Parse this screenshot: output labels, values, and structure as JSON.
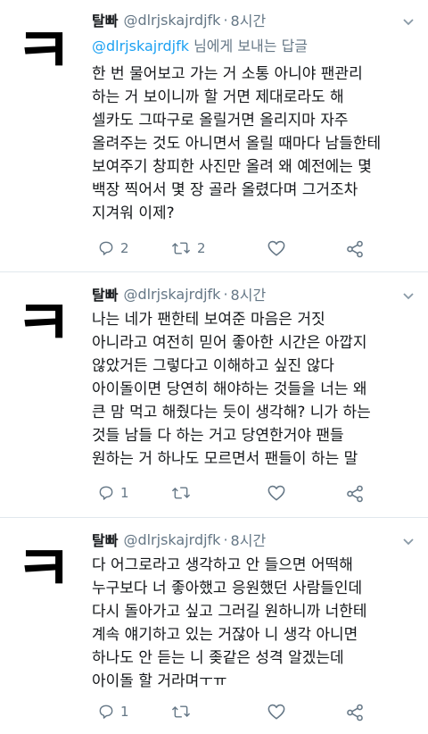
{
  "tweets": [
    {
      "avatar_char": "ㅋ",
      "name": "탈빠",
      "handle": "@dlrjskajrdjfk",
      "time": "8시간",
      "reply_to": {
        "mention": "@dlrjskajrdjfk",
        "suffix": " 님에게 보내는 답글"
      },
      "lines": [
        "한 번 물어보고 가는 거 소통 아니야 팬관리",
        "하는 거 보이니까 할 거면 제대로라도 해",
        "셀카도 그따구로 올릴거면 올리지마 자주",
        "올려주는 것도 아니면서 올릴 때마다 남들한테",
        "보여주기 창피한 사진만 올려 왜 예전에는 몇",
        "백장 찍어서 몇 장 골라 올렸다며 그거조차",
        "지겨워 이제?"
      ],
      "reply_count": "2",
      "retweet_count": "2"
    },
    {
      "avatar_char": "ㅋ",
      "name": "탈빠",
      "handle": "@dlrjskajrdjfk",
      "time": "8시간",
      "lines": [
        "나는 네가 팬한테 보여준 마음은 거짓",
        "아니라고 여전히 믿어 좋아한 시간은 아깝지",
        "않았거든 그렇다고 이해하고 싶진 않다",
        "아이돌이면 당연히 해야하는 것들을 너는 왜",
        "큰 맘 먹고 해줬다는 듯이 생각해? 니가 하는",
        "것들 남들 다 하는 거고 당연한거야 팬들",
        "원하는 거 하나도 모르면서 팬들이 하는 말"
      ],
      "reply_count": "1",
      "retweet_count": ""
    },
    {
      "avatar_char": "ㅋ",
      "name": "탈빠",
      "handle": "@dlrjskajrdjfk",
      "time": "8시간",
      "lines": [
        "다 어그로라고 생각하고 안 들으면 어떡해",
        "누구보다 너 좋아했고 응원했던 사람들인데",
        "다시 돌아가고 싶고 그러길 원하니까 너한테",
        "계속 얘기하고 있는 거잖아 니 생각 아니면",
        "하나도 안 듣는 니 좆같은 성격 알겠는데",
        "아이돌 할 거라며ㅜㅠ"
      ],
      "reply_count": "1",
      "retweet_count": ""
    }
  ],
  "colors": {
    "secondary": "#657786",
    "link": "#1da1f2",
    "text": "#14171a"
  }
}
